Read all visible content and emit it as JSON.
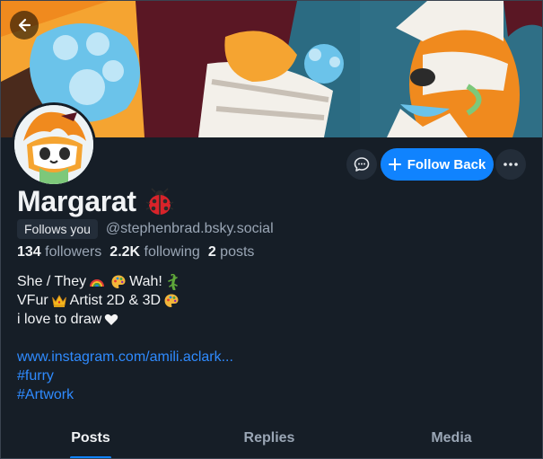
{
  "profile": {
    "display_name": "Margarat",
    "name_emoji": "ladybug-icon",
    "follows_you": "Follows you",
    "handle": "@stephenbrad.bsky.social",
    "followers_count": "134",
    "followers_label": "followers",
    "following_count": "2.2K",
    "following_label": "following",
    "posts_count": "2",
    "posts_label": "posts"
  },
  "bio": {
    "line1_a": "She / They",
    "line1_b": "Wah!",
    "line2_a": "VFur",
    "line2_b": "Artist 2D & 3D",
    "line3": "i love to draw",
    "link_url": "www.instagram.com/amili.aclark...",
    "tag1": "#furry",
    "tag2": "#Artwork"
  },
  "actions": {
    "follow_back": "Follow Back"
  },
  "tabs": [
    {
      "label": "Posts",
      "active": true
    },
    {
      "label": "Replies",
      "active": false
    },
    {
      "label": "Media",
      "active": false
    }
  ],
  "colors": {
    "background": "#161e27",
    "accent": "#1083fe",
    "muted_text": "#9aa6b5",
    "link": "#2f8bff"
  }
}
